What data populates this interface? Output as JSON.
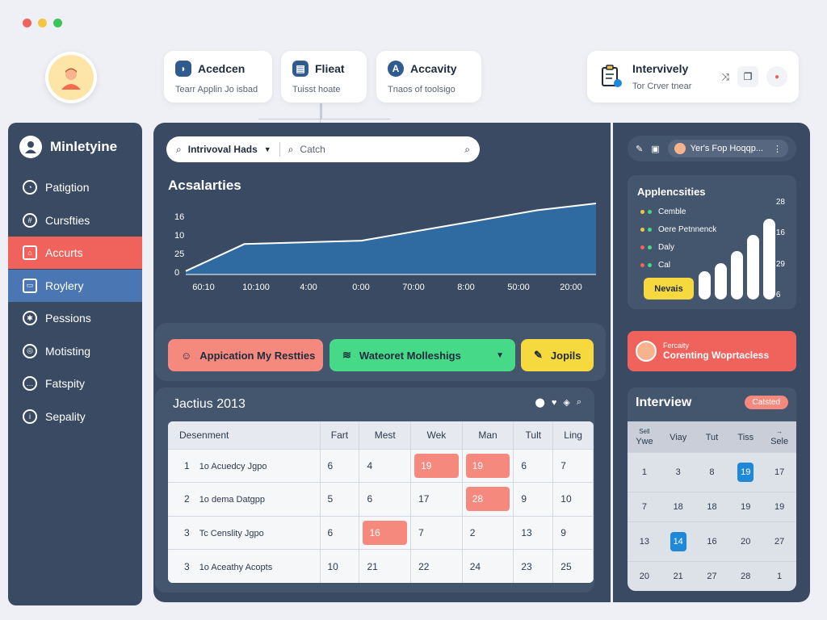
{
  "window_controls": {
    "colors": [
      "#f0625c",
      "#f4c542",
      "#3bc45a"
    ]
  },
  "top_cards": [
    {
      "icon": "user-icon",
      "title": "Acedcen",
      "sub": "Tearr Applin Jo isbad"
    },
    {
      "icon": "file-icon",
      "title": "Flieat",
      "sub": "Tuisst hoate"
    },
    {
      "icon": "a-icon",
      "title": "Accavity",
      "sub": "Tnaos of toolsigo"
    }
  ],
  "top_right_card": {
    "title": "Intervively",
    "sub": "Tor Crver tnear"
  },
  "sidebar": {
    "title": "Minletyine",
    "items": [
      {
        "label": "Patigtion",
        "icon": "clock-icon"
      },
      {
        "label": "Cursfties",
        "icon": "globe-icon"
      },
      {
        "label": "Accurts",
        "icon": "home-icon"
      },
      {
        "label": "Roylery",
        "icon": "folder-icon"
      },
      {
        "label": "Pessions",
        "icon": "settings-icon"
      },
      {
        "label": "Motisting",
        "icon": "target-icon"
      },
      {
        "label": "Fatspity",
        "icon": "chat-icon"
      },
      {
        "label": "Sepality",
        "icon": "info-icon"
      }
    ]
  },
  "search": {
    "dropdown": "Intrivoval Hads",
    "placeholder": "Catch"
  },
  "chart_data": {
    "type": "area",
    "title": "Acsalarties",
    "categories": [
      "60:10",
      "10:100",
      "4:00",
      "0:00",
      "70:00",
      "8:00",
      "50:00",
      "20:00"
    ],
    "values": [
      1,
      9,
      9.5,
      10,
      13,
      16,
      19,
      21
    ],
    "y_ticks": [
      "16",
      "10",
      "25",
      "0"
    ],
    "color": "#2f6aa0"
  },
  "actions": [
    {
      "label": "Appication My Restties",
      "color": "#f6897e"
    },
    {
      "label": "Wateoret Molleshigs",
      "color": "#45d988"
    },
    {
      "label": "Jopils",
      "color": "#f6d93e"
    }
  ],
  "table": {
    "title": "Jactius 2013",
    "headers": [
      "Desenment",
      "Fart",
      "Mest",
      "Wek",
      "Man",
      "Tult",
      "Ling"
    ],
    "rows": [
      {
        "num": "1",
        "name": "1o Acuedcy Jgpo",
        "cells": [
          "6",
          "4",
          "19",
          "19",
          "6",
          "7"
        ],
        "hl": [
          2,
          3
        ]
      },
      {
        "num": "2",
        "name": "1o dema Datgpp",
        "cells": [
          "5",
          "6",
          "17",
          "28",
          "9",
          "10"
        ],
        "hl": [
          3
        ]
      },
      {
        "num": "3",
        "name": "Tc Censlity Jgpo",
        "cells": [
          "6",
          "16",
          "7",
          "2",
          "13",
          "9"
        ],
        "hl": [
          1
        ]
      },
      {
        "num": "3",
        "name": "1o Aceathy Acopts",
        "cells": [
          "10",
          "21",
          "22",
          "24",
          "23",
          "25"
        ],
        "hl": []
      }
    ]
  },
  "right_panel": {
    "chip": "Yer's Fop Hoqqp...",
    "app_card": {
      "title": "Applencsities",
      "legend": [
        "Cemble",
        "Oere Petnnenck",
        "Daly",
        "Cal"
      ],
      "button": "Nevais",
      "right_ticks": [
        "28",
        "16",
        "29",
        "6"
      ],
      "bars": [
        0.35,
        0.45,
        0.6,
        0.8,
        1.0
      ]
    },
    "promo": {
      "small": "Fercaity",
      "label": "Corenting Woprtacless"
    },
    "interview": {
      "title": "Interview",
      "badge": "Catsted",
      "head_small": [
        "Sell",
        "",
        "",
        "",
        "→"
      ],
      "days": [
        "Ywe",
        "Viay",
        "Tut",
        "Tiss",
        "Sele"
      ],
      "dates": [
        "1",
        "3",
        "8",
        "19",
        "17",
        "7",
        "18",
        "18",
        "19",
        "19",
        "13",
        "14",
        "16",
        "20",
        "27",
        "20",
        "21",
        "27",
        "28",
        "1"
      ],
      "selected": [
        3,
        11
      ]
    }
  }
}
